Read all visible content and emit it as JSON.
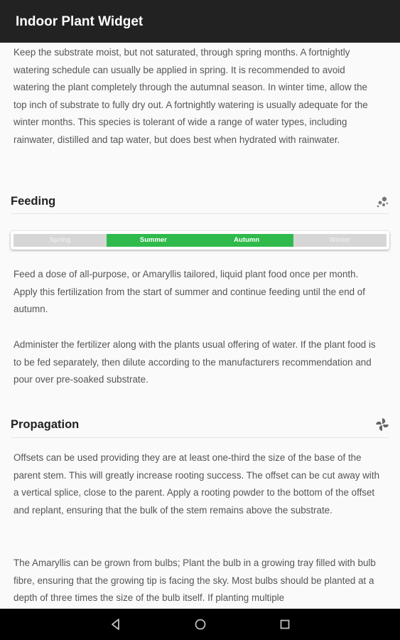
{
  "app": {
    "title": "Indoor Plant Widget"
  },
  "watering": {
    "text": "Keep the substrate moist, but not saturated, through spring months. A fortnightly watering schedule can usually be applied in spring. It is recommended to avoid watering the plant completely through the autumnal season. In winter time, allow the top inch of substrate to fully dry out. A fortnightly watering is usually adequate for the winter months. This species is tolerant of wide a range of water types, including rainwater, distilled and tap water, but does best when hydrated with rainwater."
  },
  "feeding": {
    "title": "Feeding",
    "icon": "fertilizer-icon",
    "seasons": [
      {
        "label": "Spring",
        "active": false
      },
      {
        "label": "Summer",
        "active": true
      },
      {
        "label": "Autumn",
        "active": true
      },
      {
        "label": "Winter",
        "active": false
      }
    ],
    "active_color": "#2fba4b",
    "inactive_color": "#d6d6d6",
    "paragraphs": [
      "Feed a dose of all-purpose, or Amaryllis tailored, liquid plant food once per month. Apply this fertilization from the start of summer and continue feeding until the end of autumn.",
      "Administer the fertilizer along with the plants usual offering of water. If the plant food is to be fed separately, then dilute according to the manufacturers recommendation and pour over pre-soaked substrate."
    ]
  },
  "propagation": {
    "title": "Propagation",
    "icon": "pinwheel-icon",
    "paragraphs": [
      "Offsets can be used providing they are at least one-third the size of the base of the parent stem. This will greatly increase rooting success. The offset can be cut away with a vertical splice, close to the parent. Apply a rooting powder to the bottom of the offset and replant, ensuring that the bulk of the stem remains above the substrate.",
      "The Amaryllis can be grown from bulbs; Plant the bulb in a growing tray filled with bulb fibre, ensuring that the growing tip is facing the sky. Most bulbs should be planted at a depth of three times the size of the bulb itself. If planting multiple"
    ]
  },
  "navbar": {
    "back": "back-icon",
    "home": "home-icon",
    "recents": "recents-icon"
  }
}
